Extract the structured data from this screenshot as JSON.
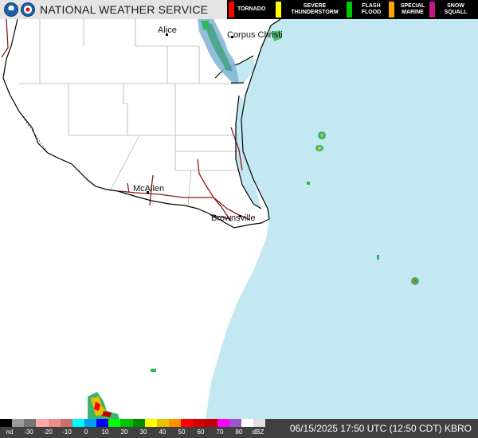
{
  "header": {
    "title": "NATIONAL WEATHER SERVICE",
    "logos": [
      "noaa-logo",
      "nws-logo"
    ],
    "warnings": [
      {
        "label": "TORNADO",
        "color": "#ff0000"
      },
      {
        "label": "SEVERE\nTHUNDERSTORM",
        "color": "#ffff00"
      },
      {
        "label": "FLASH\nFLOOD",
        "color": "#00c800"
      },
      {
        "label": "SPECIAL\nMARINE",
        "color": "#ffa500"
      },
      {
        "label": "SNOW\nSQUALL",
        "color": "#c71585"
      }
    ]
  },
  "map": {
    "land_color": "#ffffff",
    "water_color": "#c3e8f1",
    "county_line_color": "#b3b3b3",
    "coast_color": "#000000",
    "highway_color": "#8b1a1a",
    "cities": [
      {
        "name": "Alice"
      },
      {
        "name": "Corpus Christi"
      },
      {
        "name": "McAllen"
      },
      {
        "name": "Brownsville"
      }
    ]
  },
  "legend": {
    "labels": [
      "nd",
      "-30",
      "-20",
      "-10",
      "0",
      "10",
      "20",
      "30",
      "40",
      "50",
      "60",
      "70",
      "80",
      "dBZ"
    ],
    "colors": [
      "#000000",
      "#9c9c9c",
      "#767676",
      "#ffaaaa",
      "#ee8c8c",
      "#c97070",
      "#00fbfb",
      "#00a0f6",
      "#0000f6",
      "#00ff00",
      "#00c400",
      "#008c00",
      "#ffff00",
      "#e7c000",
      "#ff9000",
      "#ff0000",
      "#d60000",
      "#c00000",
      "#ff00ff",
      "#9955c9",
      "#ffffff",
      "#e0e0e0"
    ]
  },
  "timestamp": "06/15/2025 17:50 UTC (12:50 CDT) KBRO"
}
